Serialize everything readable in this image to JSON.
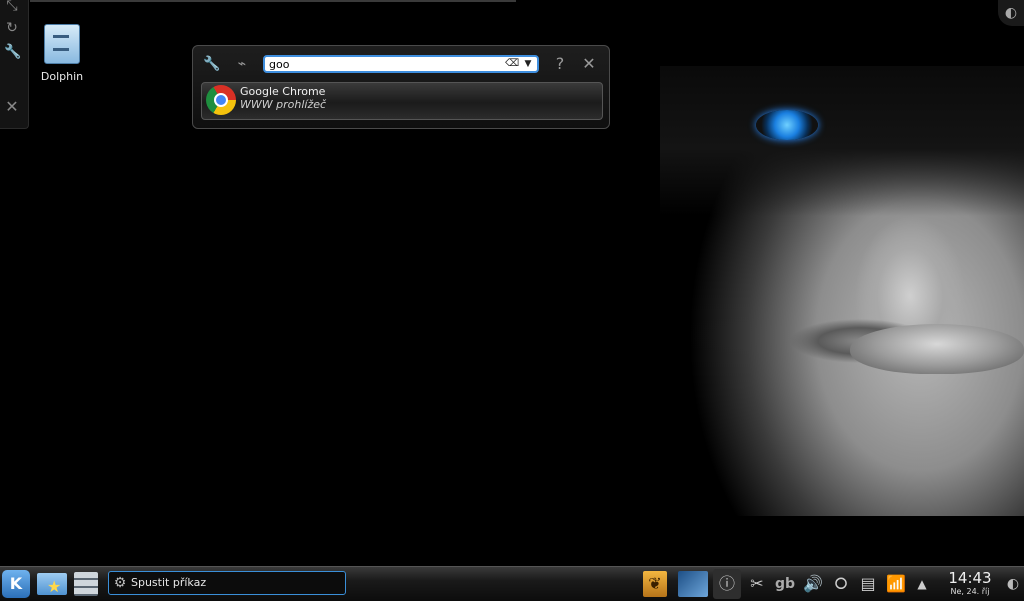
{
  "desktop": {
    "icon_label": "Dolphin",
    "toolbox_icons": [
      "resize-icon",
      "refresh-icon",
      "wrench-icon",
      "close-icon"
    ]
  },
  "krunner": {
    "search_value": "goo",
    "result": {
      "title": "Google Chrome",
      "subtitle": "WWW prohlížeč"
    },
    "help_label": "?",
    "close_label": "✕"
  },
  "taskbar": {
    "task_label": "Spustit příkaz",
    "tray_gb": "gb",
    "clock_time": "14:43",
    "clock_date": "Ne, 24. říj"
  },
  "colors": {
    "accent": "#3e8ede",
    "background": "#000000"
  }
}
